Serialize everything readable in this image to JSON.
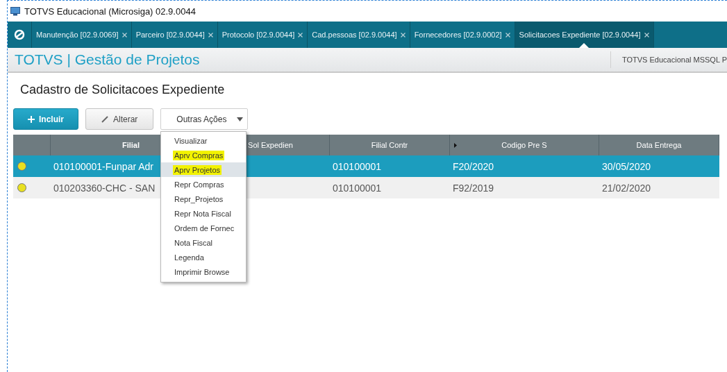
{
  "window": {
    "title": "TOTVS Educacional (Microsiga) 02.9.0044"
  },
  "tabs": [
    {
      "label": "Manutenção [02.9.0069]",
      "selected": false
    },
    {
      "label": "Parceiro [02.9.0044]",
      "selected": false
    },
    {
      "label": "Protocolo [02.9.0044]",
      "selected": false
    },
    {
      "label": "Cad.pessoas [02.9.0044]",
      "selected": false
    },
    {
      "label": "Fornecedores [02.9.0002]",
      "selected": false
    },
    {
      "label": "Solicitacoes Expediente [02.9.0044]",
      "selected": true
    }
  ],
  "header": {
    "title": "TOTVS | Gestão de Projetos",
    "environment": "TOTVS Educacional MSSQL P"
  },
  "page_title": "Cadastro de Solicitacoes Expediente",
  "toolbar": {
    "primary": "Incluir",
    "edit": "Alterar",
    "more": "Outras Ações"
  },
  "menu": [
    {
      "label": "Visualizar",
      "selected": false,
      "highlighted": false
    },
    {
      "label": "Aprv Compras",
      "selected": false,
      "highlighted": true
    },
    {
      "label": "Aprv Projetos",
      "selected": true,
      "highlighted": true
    },
    {
      "label": "Repr Compras",
      "selected": false,
      "highlighted": false
    },
    {
      "label": "Repr_Projetos",
      "selected": false,
      "highlighted": false
    },
    {
      "label": "Repr Nota Fiscal",
      "selected": false,
      "highlighted": false
    },
    {
      "label": "Ordem de Fornec",
      "selected": false,
      "highlighted": false
    },
    {
      "label": "Nota Fiscal",
      "selected": false,
      "highlighted": false
    },
    {
      "label": "Legenda",
      "selected": false,
      "highlighted": false
    },
    {
      "label": "Imprimir Browse",
      "selected": false,
      "highlighted": false
    }
  ],
  "table": {
    "columns": [
      "Filial",
      "Sol Expedien",
      "Filial Contr",
      "Codigo Pre S",
      "Data Entrega"
    ],
    "rows": [
      {
        "selected": true,
        "color": "#e8e020",
        "cells": [
          "010100001-Funpar Adr",
          "",
          "010100001",
          "F20/2020",
          "30/05/2020"
        ]
      },
      {
        "selected": false,
        "color": "#e8e020",
        "cells": [
          "010203360-CHC - SAN",
          "",
          "010100001",
          "F92/2019",
          "21/02/2020"
        ]
      }
    ]
  }
}
